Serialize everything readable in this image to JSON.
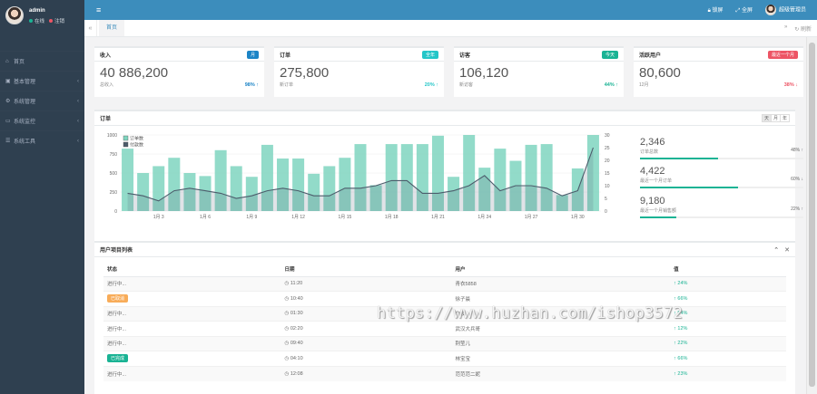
{
  "sidebar": {
    "username": "admin",
    "status_online": "在线",
    "status_logout": "注销",
    "items": [
      {
        "icon": "home-icon",
        "label": "首页",
        "has_children": false
      },
      {
        "icon": "cube-icon",
        "label": "基本管理",
        "has_children": true
      },
      {
        "icon": "gear-icon",
        "label": "系统管理",
        "has_children": true
      },
      {
        "icon": "monitor-icon",
        "label": "系统监控",
        "has_children": true
      },
      {
        "icon": "list-icon",
        "label": "系统工具",
        "has_children": true
      }
    ]
  },
  "topbar": {
    "lock_label": "锁屏",
    "fullscreen_label": "全屏",
    "user_label": "超级管理员"
  },
  "tabs": {
    "items": [
      {
        "label": "首页"
      }
    ],
    "refresh_label": "刷新"
  },
  "stats": [
    {
      "title": "收入",
      "badge": "月",
      "badge_color": "#1c84c6",
      "value": "40 886,200",
      "sub": "总收入",
      "pct": "98%",
      "arrow": "↑",
      "pct_color": "#1c84c6"
    },
    {
      "title": "订单",
      "badge": "全年",
      "badge_color": "#23c6c8",
      "value": "275,800",
      "sub": "新订单",
      "pct": "20%",
      "arrow": "↑",
      "pct_color": "#23c6c8"
    },
    {
      "title": "访客",
      "badge": "今天",
      "badge_color": "#1ab394",
      "value": "106,120",
      "sub": "新访客",
      "pct": "44%",
      "arrow": "↑",
      "pct_color": "#1ab394"
    },
    {
      "title": "活跃用户",
      "badge": "最近一个月",
      "badge_color": "#ed5565",
      "value": "80,600",
      "sub": "12月",
      "pct": "38%",
      "arrow": "↓",
      "pct_color": "#ed5565"
    }
  ],
  "orders_panel": {
    "title": "订单",
    "buttons": [
      "天",
      "月",
      "年"
    ],
    "mini_stats": [
      {
        "value": "2,346",
        "label": "订单总数",
        "pct": "48%",
        "arrow": "↑",
        "fill": 0.48
      },
      {
        "value": "4,422",
        "label": "最近一个月订单",
        "pct": "60%",
        "arrow": "↓",
        "fill": 0.6
      },
      {
        "value": "9,180",
        "label": "最近一个月销售额",
        "pct": "22%",
        "arrow": "↑",
        "fill": 0.22
      }
    ]
  },
  "chart_data": {
    "type": "bar",
    "series": [
      {
        "name": "订单数",
        "values": [
          820,
          500,
          590,
          700,
          500,
          460,
          800,
          590,
          450,
          870,
          690,
          690,
          490,
          590,
          700,
          880,
          340,
          880,
          880,
          880,
          990,
          450,
          1000,
          570,
          820,
          660,
          870,
          880,
          210,
          560,
          1000
        ],
        "color": "#7fd5bf"
      },
      {
        "name": "付款数",
        "values": [
          7,
          6,
          4,
          8,
          9,
          8,
          7,
          5,
          6,
          8,
          9,
          8,
          6,
          6,
          9,
          9,
          10,
          12,
          12,
          7,
          7,
          8,
          10,
          14,
          8,
          10,
          10,
          9,
          6,
          8,
          25
        ],
        "color": "#4c5c6b"
      }
    ],
    "x_tick_labels": [
      "1月 3",
      "1月 6",
      "1月 9",
      "1月 12",
      "1月 15",
      "1月 18",
      "1月 21",
      "1月 24",
      "1月 27",
      "1月 30"
    ],
    "x_tick_indices": [
      2,
      5,
      8,
      11,
      14,
      17,
      20,
      23,
      26,
      29
    ],
    "y_ticks_left": [
      0,
      250,
      500,
      750,
      1000
    ],
    "y_ticks_right": [
      0,
      5,
      10,
      15,
      20,
      25,
      30
    ],
    "ylim_left": [
      0,
      1000
    ],
    "ylim_right": [
      0,
      30
    ],
    "legend": "top-left"
  },
  "table_panel": {
    "title": "用户项目列表",
    "columns": [
      "状态",
      "日期",
      "用户",
      "值"
    ],
    "rows": [
      {
        "status": "进行中...",
        "status_type": "text",
        "date": "11:20",
        "user": "青衣5858",
        "value": "24%"
      },
      {
        "status": "已取消",
        "status_type": "label",
        "label_color": "#f8ac59",
        "date": "10:40",
        "user": "徐子晨",
        "value": "66%"
      },
      {
        "status": "进行中...",
        "status_type": "text",
        "date": "01:30",
        "user": "奔波",
        "value": "54%"
      },
      {
        "status": "进行中...",
        "status_type": "text",
        "date": "02:20",
        "user": "武汉大兵哥",
        "value": "12%"
      },
      {
        "status": "进行中...",
        "status_type": "text",
        "date": "09:40",
        "user": "荆莹儿",
        "value": "22%"
      },
      {
        "status": "已完成",
        "status_type": "label",
        "label_color": "#1ab394",
        "date": "04:10",
        "user": "林宝宝",
        "value": "66%"
      },
      {
        "status": "进行中...",
        "status_type": "text",
        "date": "12:08",
        "user": "范范范二妮",
        "value": "23%"
      }
    ]
  },
  "watermark": "https://www.huzhan.com/ishop3572"
}
